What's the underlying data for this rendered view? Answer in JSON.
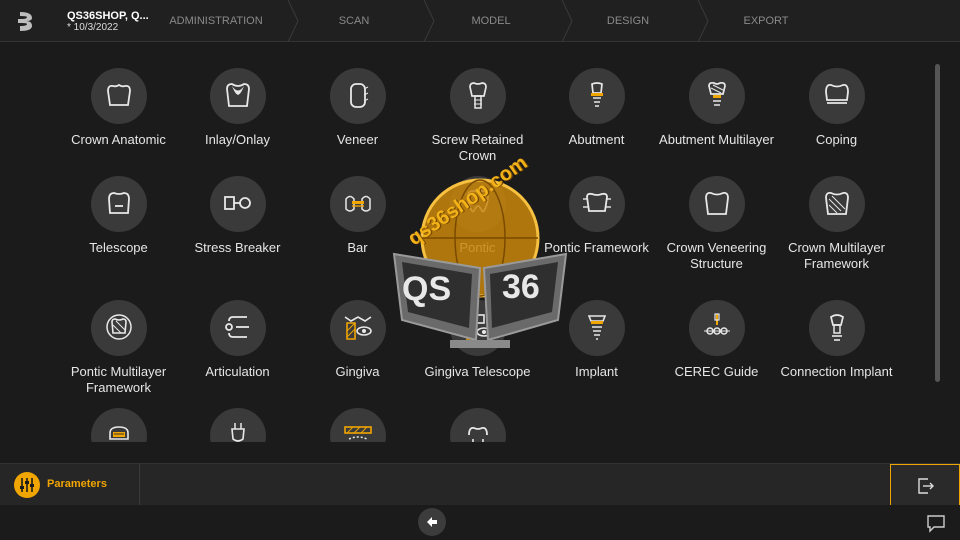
{
  "header": {
    "case_title": "QS36SHOP, Q...",
    "case_date": "* 10/3/2022",
    "steps": [
      "ADMINISTRATION",
      "SCAN",
      "MODEL",
      "DESIGN",
      "EXPORT"
    ]
  },
  "tiles": [
    {
      "label": "Crown Anatomic",
      "icon": "crown-anatomic-icon"
    },
    {
      "label": "Inlay/Onlay",
      "icon": "inlay-onlay-icon"
    },
    {
      "label": "Veneer",
      "icon": "veneer-icon"
    },
    {
      "label": "Screw Retained Crown",
      "icon": "screw-retained-crown-icon"
    },
    {
      "label": "Abutment",
      "icon": "abutment-icon"
    },
    {
      "label": "Abutment Multilayer",
      "icon": "abutment-multilayer-icon"
    },
    {
      "label": "Coping",
      "icon": "coping-icon"
    },
    {
      "label": "Telescope",
      "icon": "telescope-icon"
    },
    {
      "label": "Stress Breaker",
      "icon": "stress-breaker-icon"
    },
    {
      "label": "Bar",
      "icon": "bar-icon"
    },
    {
      "label": "Pontic",
      "icon": "pontic-icon"
    },
    {
      "label": "Pontic Framework",
      "icon": "pontic-framework-icon"
    },
    {
      "label": "Crown Veneering Structure",
      "icon": "crown-veneering-structure-icon"
    },
    {
      "label": "Crown Multilayer Framework",
      "icon": "crown-multilayer-framework-icon"
    },
    {
      "label": "Pontic Multilayer Framework",
      "icon": "pontic-multilayer-framework-icon"
    },
    {
      "label": "Articulation",
      "icon": "articulation-icon"
    },
    {
      "label": "Gingiva",
      "icon": "gingiva-icon"
    },
    {
      "label": "Gingiva Telescope",
      "icon": "gingiva-telescope-icon"
    },
    {
      "label": "Implant",
      "icon": "implant-icon"
    },
    {
      "label": "CEREC Guide",
      "icon": "cerec-guide-icon"
    },
    {
      "label": "Connection Implant",
      "icon": "connection-implant-icon"
    },
    {
      "label": "",
      "icon": "bridge-icon"
    },
    {
      "label": "",
      "icon": "post-icon"
    },
    {
      "label": "",
      "icon": "gingiva-mask-icon"
    },
    {
      "label": "",
      "icon": "tooth-icon"
    }
  ],
  "parameters": {
    "label": "Parameters",
    "icon": "parameters-sliders-icon"
  },
  "exit": {
    "icon": "exit-icon"
  },
  "footer": {
    "back_icon": "back-arrow-icon",
    "chat_icon": "chat-icon"
  },
  "watermark": {
    "text": "qs36shop.com",
    "left_screen": "QS",
    "right_screen": "36"
  },
  "colors": {
    "accent": "#f0a500",
    "tile_bg": "#3a3a3a",
    "background": "#1b1b1b"
  }
}
